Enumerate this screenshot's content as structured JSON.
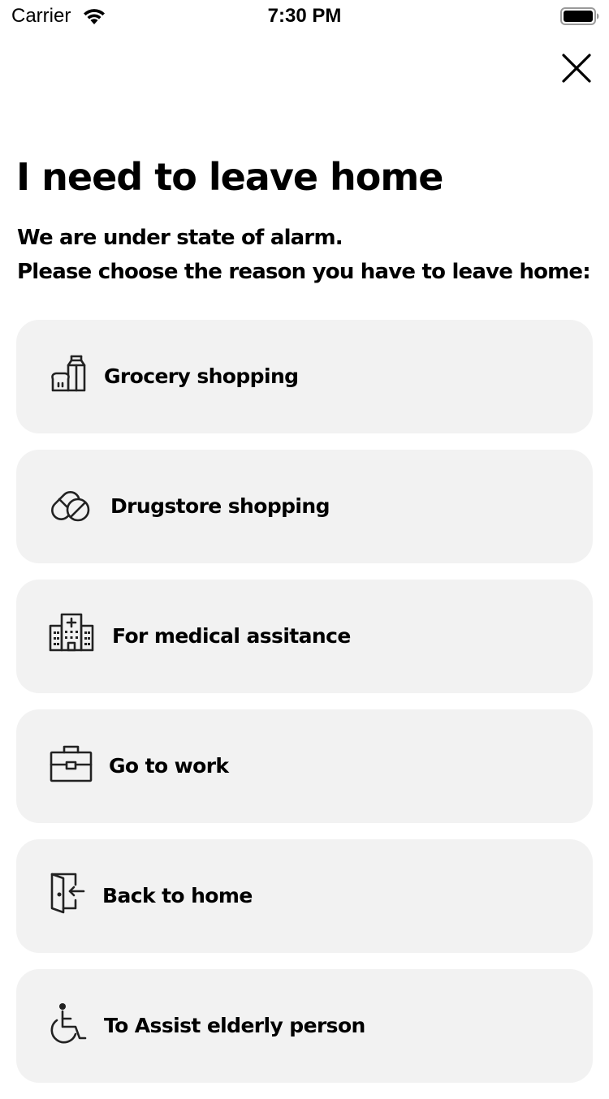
{
  "status_bar": {
    "carrier": "Carrier",
    "time": "7:30 PM"
  },
  "header": {
    "close_icon": "close-icon"
  },
  "title": "I need to leave home",
  "subtitle": {
    "line1": "We are under state of alarm.",
    "line2": "Please choose the reason you have to leave home:"
  },
  "reasons": [
    {
      "label": "Grocery shopping",
      "icon": "grocery-icon"
    },
    {
      "label": "Drugstore shopping",
      "icon": "pills-icon"
    },
    {
      "label": "For medical assitance",
      "icon": "hospital-icon"
    },
    {
      "label": "Go to work",
      "icon": "briefcase-icon"
    },
    {
      "label": "Back to home",
      "icon": "door-enter-icon"
    },
    {
      "label": "To Assist elderly person",
      "icon": "wheelchair-icon"
    }
  ],
  "colors": {
    "card_background": "#f2f2f2",
    "text": "#000000",
    "icon_stroke": "#222222"
  }
}
